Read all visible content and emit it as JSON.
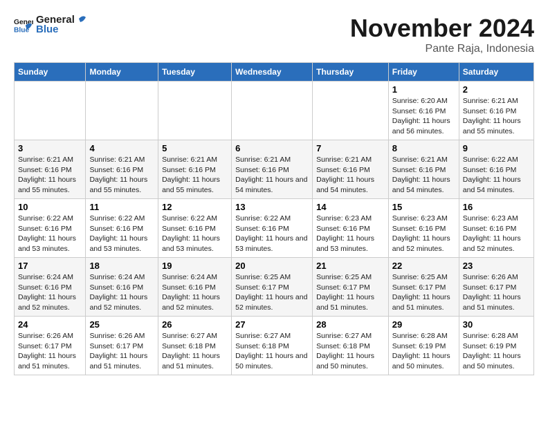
{
  "logo": {
    "text_general": "General",
    "text_blue": "Blue"
  },
  "header": {
    "title": "November 2024",
    "subtitle": "Pante Raja, Indonesia"
  },
  "weekdays": [
    "Sunday",
    "Monday",
    "Tuesday",
    "Wednesday",
    "Thursday",
    "Friday",
    "Saturday"
  ],
  "weeks": [
    [
      {
        "day": "",
        "info": ""
      },
      {
        "day": "",
        "info": ""
      },
      {
        "day": "",
        "info": ""
      },
      {
        "day": "",
        "info": ""
      },
      {
        "day": "",
        "info": ""
      },
      {
        "day": "1",
        "info": "Sunrise: 6:20 AM\nSunset: 6:16 PM\nDaylight: 11 hours and 56 minutes."
      },
      {
        "day": "2",
        "info": "Sunrise: 6:21 AM\nSunset: 6:16 PM\nDaylight: 11 hours and 55 minutes."
      }
    ],
    [
      {
        "day": "3",
        "info": "Sunrise: 6:21 AM\nSunset: 6:16 PM\nDaylight: 11 hours and 55 minutes."
      },
      {
        "day": "4",
        "info": "Sunrise: 6:21 AM\nSunset: 6:16 PM\nDaylight: 11 hours and 55 minutes."
      },
      {
        "day": "5",
        "info": "Sunrise: 6:21 AM\nSunset: 6:16 PM\nDaylight: 11 hours and 55 minutes."
      },
      {
        "day": "6",
        "info": "Sunrise: 6:21 AM\nSunset: 6:16 PM\nDaylight: 11 hours and 54 minutes."
      },
      {
        "day": "7",
        "info": "Sunrise: 6:21 AM\nSunset: 6:16 PM\nDaylight: 11 hours and 54 minutes."
      },
      {
        "day": "8",
        "info": "Sunrise: 6:21 AM\nSunset: 6:16 PM\nDaylight: 11 hours and 54 minutes."
      },
      {
        "day": "9",
        "info": "Sunrise: 6:22 AM\nSunset: 6:16 PM\nDaylight: 11 hours and 54 minutes."
      }
    ],
    [
      {
        "day": "10",
        "info": "Sunrise: 6:22 AM\nSunset: 6:16 PM\nDaylight: 11 hours and 53 minutes."
      },
      {
        "day": "11",
        "info": "Sunrise: 6:22 AM\nSunset: 6:16 PM\nDaylight: 11 hours and 53 minutes."
      },
      {
        "day": "12",
        "info": "Sunrise: 6:22 AM\nSunset: 6:16 PM\nDaylight: 11 hours and 53 minutes."
      },
      {
        "day": "13",
        "info": "Sunrise: 6:22 AM\nSunset: 6:16 PM\nDaylight: 11 hours and 53 minutes."
      },
      {
        "day": "14",
        "info": "Sunrise: 6:23 AM\nSunset: 6:16 PM\nDaylight: 11 hours and 53 minutes."
      },
      {
        "day": "15",
        "info": "Sunrise: 6:23 AM\nSunset: 6:16 PM\nDaylight: 11 hours and 52 minutes."
      },
      {
        "day": "16",
        "info": "Sunrise: 6:23 AM\nSunset: 6:16 PM\nDaylight: 11 hours and 52 minutes."
      }
    ],
    [
      {
        "day": "17",
        "info": "Sunrise: 6:24 AM\nSunset: 6:16 PM\nDaylight: 11 hours and 52 minutes."
      },
      {
        "day": "18",
        "info": "Sunrise: 6:24 AM\nSunset: 6:16 PM\nDaylight: 11 hours and 52 minutes."
      },
      {
        "day": "19",
        "info": "Sunrise: 6:24 AM\nSunset: 6:16 PM\nDaylight: 11 hours and 52 minutes."
      },
      {
        "day": "20",
        "info": "Sunrise: 6:25 AM\nSunset: 6:17 PM\nDaylight: 11 hours and 52 minutes."
      },
      {
        "day": "21",
        "info": "Sunrise: 6:25 AM\nSunset: 6:17 PM\nDaylight: 11 hours and 51 minutes."
      },
      {
        "day": "22",
        "info": "Sunrise: 6:25 AM\nSunset: 6:17 PM\nDaylight: 11 hours and 51 minutes."
      },
      {
        "day": "23",
        "info": "Sunrise: 6:26 AM\nSunset: 6:17 PM\nDaylight: 11 hours and 51 minutes."
      }
    ],
    [
      {
        "day": "24",
        "info": "Sunrise: 6:26 AM\nSunset: 6:17 PM\nDaylight: 11 hours and 51 minutes."
      },
      {
        "day": "25",
        "info": "Sunrise: 6:26 AM\nSunset: 6:17 PM\nDaylight: 11 hours and 51 minutes."
      },
      {
        "day": "26",
        "info": "Sunrise: 6:27 AM\nSunset: 6:18 PM\nDaylight: 11 hours and 51 minutes."
      },
      {
        "day": "27",
        "info": "Sunrise: 6:27 AM\nSunset: 6:18 PM\nDaylight: 11 hours and 50 minutes."
      },
      {
        "day": "28",
        "info": "Sunrise: 6:27 AM\nSunset: 6:18 PM\nDaylight: 11 hours and 50 minutes."
      },
      {
        "day": "29",
        "info": "Sunrise: 6:28 AM\nSunset: 6:19 PM\nDaylight: 11 hours and 50 minutes."
      },
      {
        "day": "30",
        "info": "Sunrise: 6:28 AM\nSunset: 6:19 PM\nDaylight: 11 hours and 50 minutes."
      }
    ]
  ]
}
